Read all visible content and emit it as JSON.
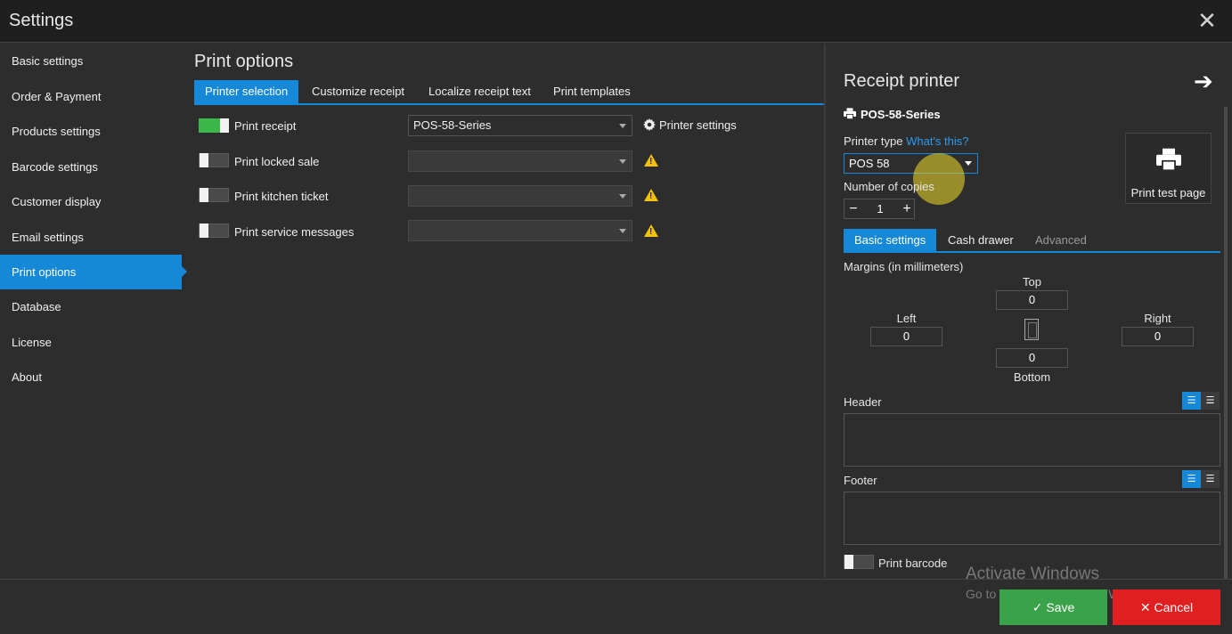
{
  "window": {
    "title": "Settings",
    "close_glyph": "✕"
  },
  "sidebar": {
    "items": [
      {
        "label": "Basic settings",
        "active": false
      },
      {
        "label": "Order & Payment",
        "active": false
      },
      {
        "label": "Products settings",
        "active": false
      },
      {
        "label": "Barcode settings",
        "active": false
      },
      {
        "label": "Customer display",
        "active": false
      },
      {
        "label": "Email settings",
        "active": false
      },
      {
        "label": "Print options",
        "active": true
      },
      {
        "label": "Database",
        "active": false
      },
      {
        "label": "License",
        "active": false
      },
      {
        "label": "About",
        "active": false
      }
    ]
  },
  "main": {
    "title": "Print options",
    "tabs": [
      {
        "label": "Printer selection",
        "active": true
      },
      {
        "label": "Customize receipt",
        "active": false
      },
      {
        "label": "Localize receipt text",
        "active": false
      },
      {
        "label": "Print templates",
        "active": false
      }
    ],
    "rows": [
      {
        "label": "Print receipt",
        "enabled": true,
        "printer": "POS-58-Series"
      },
      {
        "label": "Print locked sale",
        "enabled": false,
        "printer": ""
      },
      {
        "label": "Print kitchen ticket",
        "enabled": false,
        "printer": ""
      },
      {
        "label": "Print service messages",
        "enabled": false,
        "printer": ""
      }
    ],
    "printer_settings_label": "Printer settings",
    "warning_glyph": "!"
  },
  "right_panel": {
    "title": "Receipt printer",
    "arrow_glyph": "➔",
    "printer_name": "POS-58-Series",
    "printer_type_label": "Printer type",
    "whats_this": "What's this?",
    "printer_type_value": "POS 58",
    "copies_label": "Number of copies",
    "copies_value": "1",
    "minus": "−",
    "plus": "+",
    "test_page_label": "Print test page",
    "tabs": [
      {
        "label": "Basic settings",
        "active": true
      },
      {
        "label": "Cash drawer",
        "active": false
      },
      {
        "label": "Advanced",
        "active": false
      }
    ],
    "margins_label": "Margins (in millimeters)",
    "margins": {
      "top_label": "Top",
      "top": "0",
      "left_label": "Left",
      "left": "0",
      "right_label": "Right",
      "right": "0",
      "bottom_label": "Bottom",
      "bottom": "0"
    },
    "header_label": "Header",
    "footer_label": "Footer",
    "print_barcode_label": "Print barcode"
  },
  "footer": {
    "save_label": "Save",
    "cancel_label": "Cancel",
    "watermark_title": "Activate Windows",
    "watermark_sub": "Go to Settings to activate Windows."
  },
  "colors": {
    "accent": "#1688d8",
    "toggle_on": "#3cb84a",
    "save": "#3aa34a",
    "cancel": "#e02020",
    "warning": "#f4c20d"
  },
  "icons": [
    "close-icon",
    "gear-icon",
    "warning-icon",
    "arrow-right-icon",
    "printer-icon",
    "page-icon",
    "align-left-icon",
    "align-center-icon",
    "check-icon",
    "x-icon"
  ]
}
